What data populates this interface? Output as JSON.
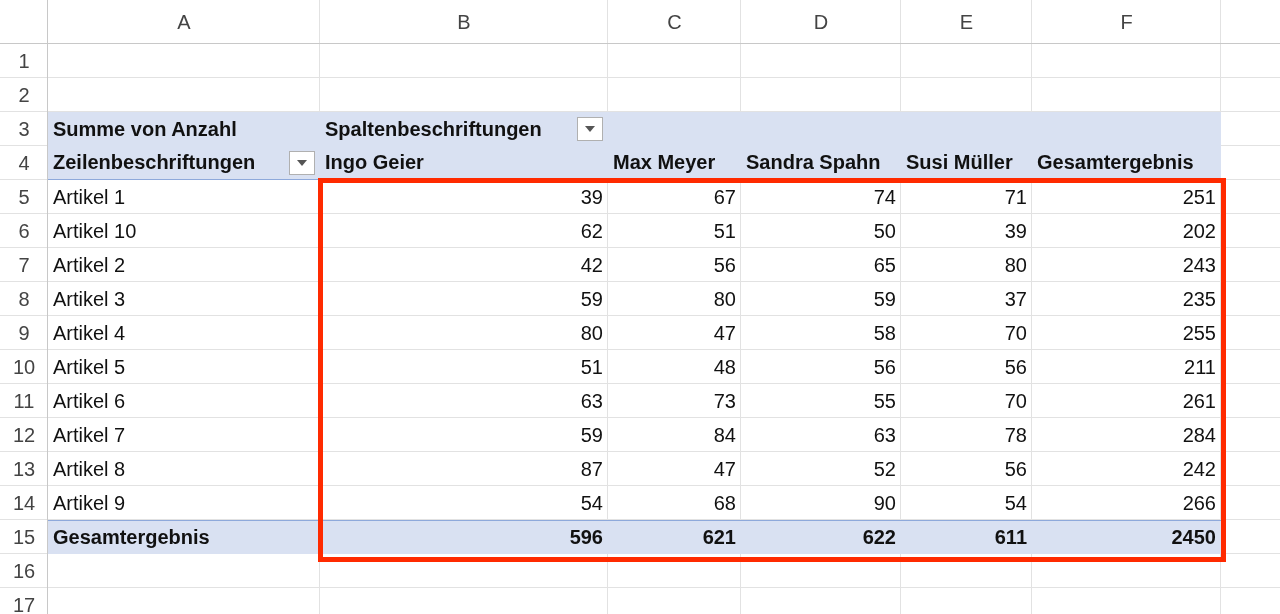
{
  "columns": [
    "A",
    "B",
    "C",
    "D",
    "E",
    "F"
  ],
  "rows": [
    {
      "number": "1",
      "kind": "empty",
      "cells": []
    },
    {
      "number": "2",
      "kind": "empty",
      "cells": []
    },
    {
      "number": "3",
      "kind": "pivot-title",
      "cells": [
        {
          "text": "Summe von Anzahl",
          "dropdown": false
        },
        {
          "text": "Spaltenbeschriftungen",
          "dropdown": true
        },
        {
          "text": "",
          "dropdown": false
        },
        {
          "text": "",
          "dropdown": false
        },
        {
          "text": "",
          "dropdown": false
        },
        {
          "text": "",
          "dropdown": false
        }
      ]
    },
    {
      "number": "4",
      "kind": "pivot-header",
      "cells": [
        {
          "text": "Zeilenbeschriftungen",
          "dropdown": true
        },
        {
          "text": "Ingo Geier",
          "dropdown": false
        },
        {
          "text": "Max Meyer",
          "dropdown": false
        },
        {
          "text": "Sandra Spahn",
          "dropdown": false
        },
        {
          "text": "Susi Müller",
          "dropdown": false
        },
        {
          "text": "Gesamtergebnis",
          "dropdown": false
        }
      ]
    },
    {
      "number": "5",
      "kind": "data",
      "cells": [
        "Artikel 1",
        "39",
        "67",
        "74",
        "71",
        "251"
      ]
    },
    {
      "number": "6",
      "kind": "data",
      "cells": [
        "Artikel 10",
        "62",
        "51",
        "50",
        "39",
        "202"
      ]
    },
    {
      "number": "7",
      "kind": "data",
      "cells": [
        "Artikel 2",
        "42",
        "56",
        "65",
        "80",
        "243"
      ]
    },
    {
      "number": "8",
      "kind": "data",
      "cells": [
        "Artikel 3",
        "59",
        "80",
        "59",
        "37",
        "235"
      ]
    },
    {
      "number": "9",
      "kind": "data",
      "cells": [
        "Artikel 4",
        "80",
        "47",
        "58",
        "70",
        "255"
      ]
    },
    {
      "number": "10",
      "kind": "data",
      "cells": [
        "Artikel 5",
        "51",
        "48",
        "56",
        "56",
        "211"
      ]
    },
    {
      "number": "11",
      "kind": "data",
      "cells": [
        "Artikel 6",
        "63",
        "73",
        "55",
        "70",
        "261"
      ]
    },
    {
      "number": "12",
      "kind": "data",
      "cells": [
        "Artikel 7",
        "59",
        "84",
        "63",
        "78",
        "284"
      ]
    },
    {
      "number": "13",
      "kind": "data",
      "cells": [
        "Artikel 8",
        "87",
        "47",
        "52",
        "56",
        "242"
      ]
    },
    {
      "number": "14",
      "kind": "data",
      "cells": [
        "Artikel 9",
        "54",
        "68",
        "90",
        "54",
        "266"
      ]
    },
    {
      "number": "15",
      "kind": "total",
      "cells": [
        "Gesamtergebnis",
        "596",
        "621",
        "622",
        "611",
        "2450"
      ]
    },
    {
      "number": "16",
      "kind": "empty",
      "cells": []
    },
    {
      "number": "17",
      "kind": "empty",
      "cells": []
    }
  ]
}
